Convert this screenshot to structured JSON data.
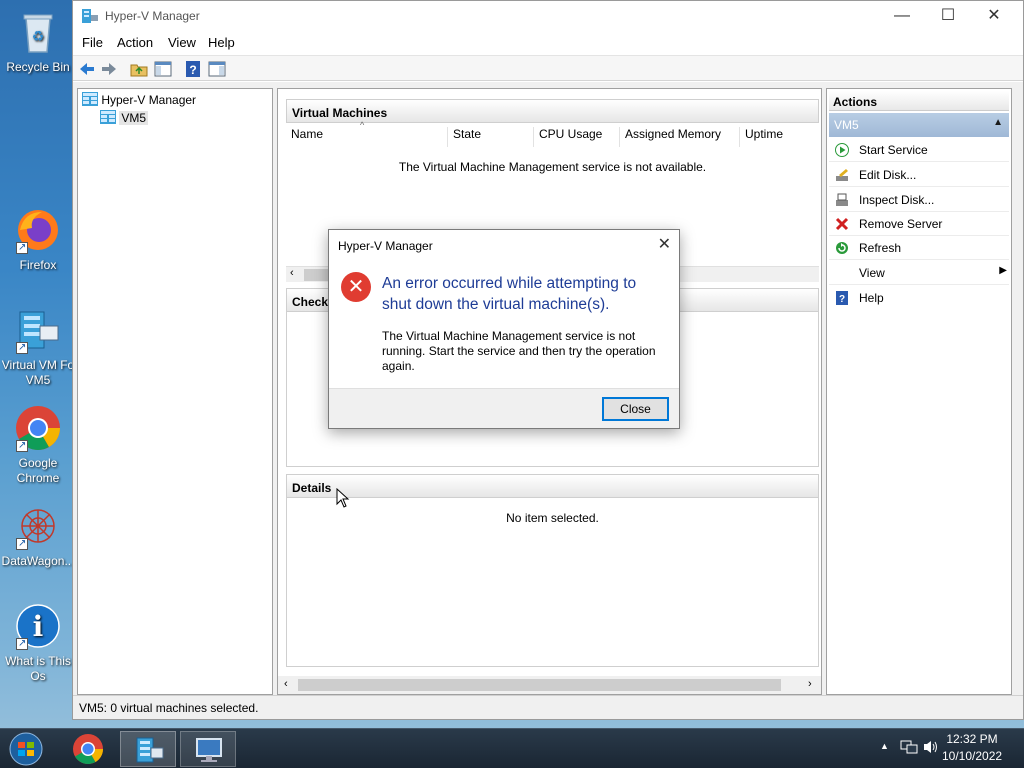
{
  "desktop": {
    "icons": [
      {
        "label": "Recycle Bin"
      },
      {
        "label": "Firefox"
      },
      {
        "label": "Virtual VM Fo VM5"
      },
      {
        "label": "Google Chrome"
      },
      {
        "label": "DataWagon..."
      },
      {
        "label": "What is This Os"
      }
    ]
  },
  "window": {
    "title": "Hyper-V Manager",
    "menu": [
      "File",
      "Action",
      "View",
      "Help"
    ],
    "tree": {
      "root": "Hyper-V Manager",
      "child": "VM5"
    },
    "vm_section": {
      "title": "Virtual Machines",
      "columns": [
        "Name",
        "State",
        "CPU Usage",
        "Assigned Memory",
        "Uptime"
      ],
      "empty_message": "The Virtual Machine Management service is not available."
    },
    "checkpoints_section": {
      "title": "Checkp"
    },
    "details_section": {
      "title": "Details",
      "empty_message": "No item selected."
    },
    "actions": {
      "title": "Actions",
      "group": "VM5",
      "items": [
        {
          "label": "Start Service",
          "icon": "start-icon"
        },
        {
          "label": "Edit Disk...",
          "icon": "edit-disk-icon"
        },
        {
          "label": "Inspect Disk...",
          "icon": "inspect-disk-icon"
        },
        {
          "label": "Remove Server",
          "icon": "remove-icon"
        },
        {
          "label": "Refresh",
          "icon": "refresh-icon"
        },
        {
          "label": "View",
          "icon": "submenu-arrow-icon"
        },
        {
          "label": "Help",
          "icon": "help-icon"
        }
      ]
    },
    "status": "VM5:  0 virtual machines selected."
  },
  "dialog": {
    "title": "Hyper-V Manager",
    "headline": "An error occurred while attempting to shut down the virtual machine(s).",
    "message": "The Virtual Machine Management service is not running. Start the service and then try the operation again.",
    "close_label": "Close"
  },
  "taskbar": {
    "time": "12:32 PM",
    "date": "10/10/2022"
  },
  "colors": {
    "accent": "#0078d7",
    "error": "#e03c31",
    "headline": "#1e3c96"
  }
}
